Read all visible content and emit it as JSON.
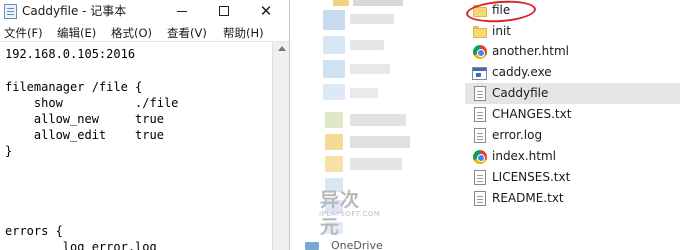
{
  "notepad": {
    "title": "Caddyfile - 记事本",
    "controls": {
      "minimize": "—",
      "maximize": "☐",
      "close": "✕"
    },
    "menu": [
      "文件(F)",
      "编辑(E)",
      "格式(O)",
      "查看(V)",
      "帮助(H)"
    ],
    "lines": [
      "192.168.0.105:2016",
      "",
      "filemanager /file {",
      "    show          ./file",
      "    allow_new     true",
      "    allow_edit    true",
      "}",
      "",
      "",
      "",
      "",
      "errors {",
      "        log error.log"
    ]
  },
  "explorer": {
    "nav_bottom_label": "OneDrive",
    "files": [
      {
        "name": "file",
        "icon": "folder-icon"
      },
      {
        "name": "init",
        "icon": "folder-icon"
      },
      {
        "name": "another.html",
        "icon": "chrome-icon"
      },
      {
        "name": "caddy.exe",
        "icon": "exe-icon"
      },
      {
        "name": "Caddyfile",
        "icon": "document-icon",
        "selected": true
      },
      {
        "name": "CHANGES.txt",
        "icon": "document-icon"
      },
      {
        "name": "error.log",
        "icon": "document-icon"
      },
      {
        "name": "index.html",
        "icon": "chrome-icon"
      },
      {
        "name": "LICENSES.txt",
        "icon": "document-icon"
      },
      {
        "name": "README.txt",
        "icon": "document-icon"
      }
    ]
  },
  "watermark": {
    "primary": "异次元",
    "secondary": "IPLAYSOFT.COM"
  },
  "colors": {
    "annotation": "#d9262c",
    "selection": "#e5e5e5",
    "folder": "#f8d775"
  }
}
